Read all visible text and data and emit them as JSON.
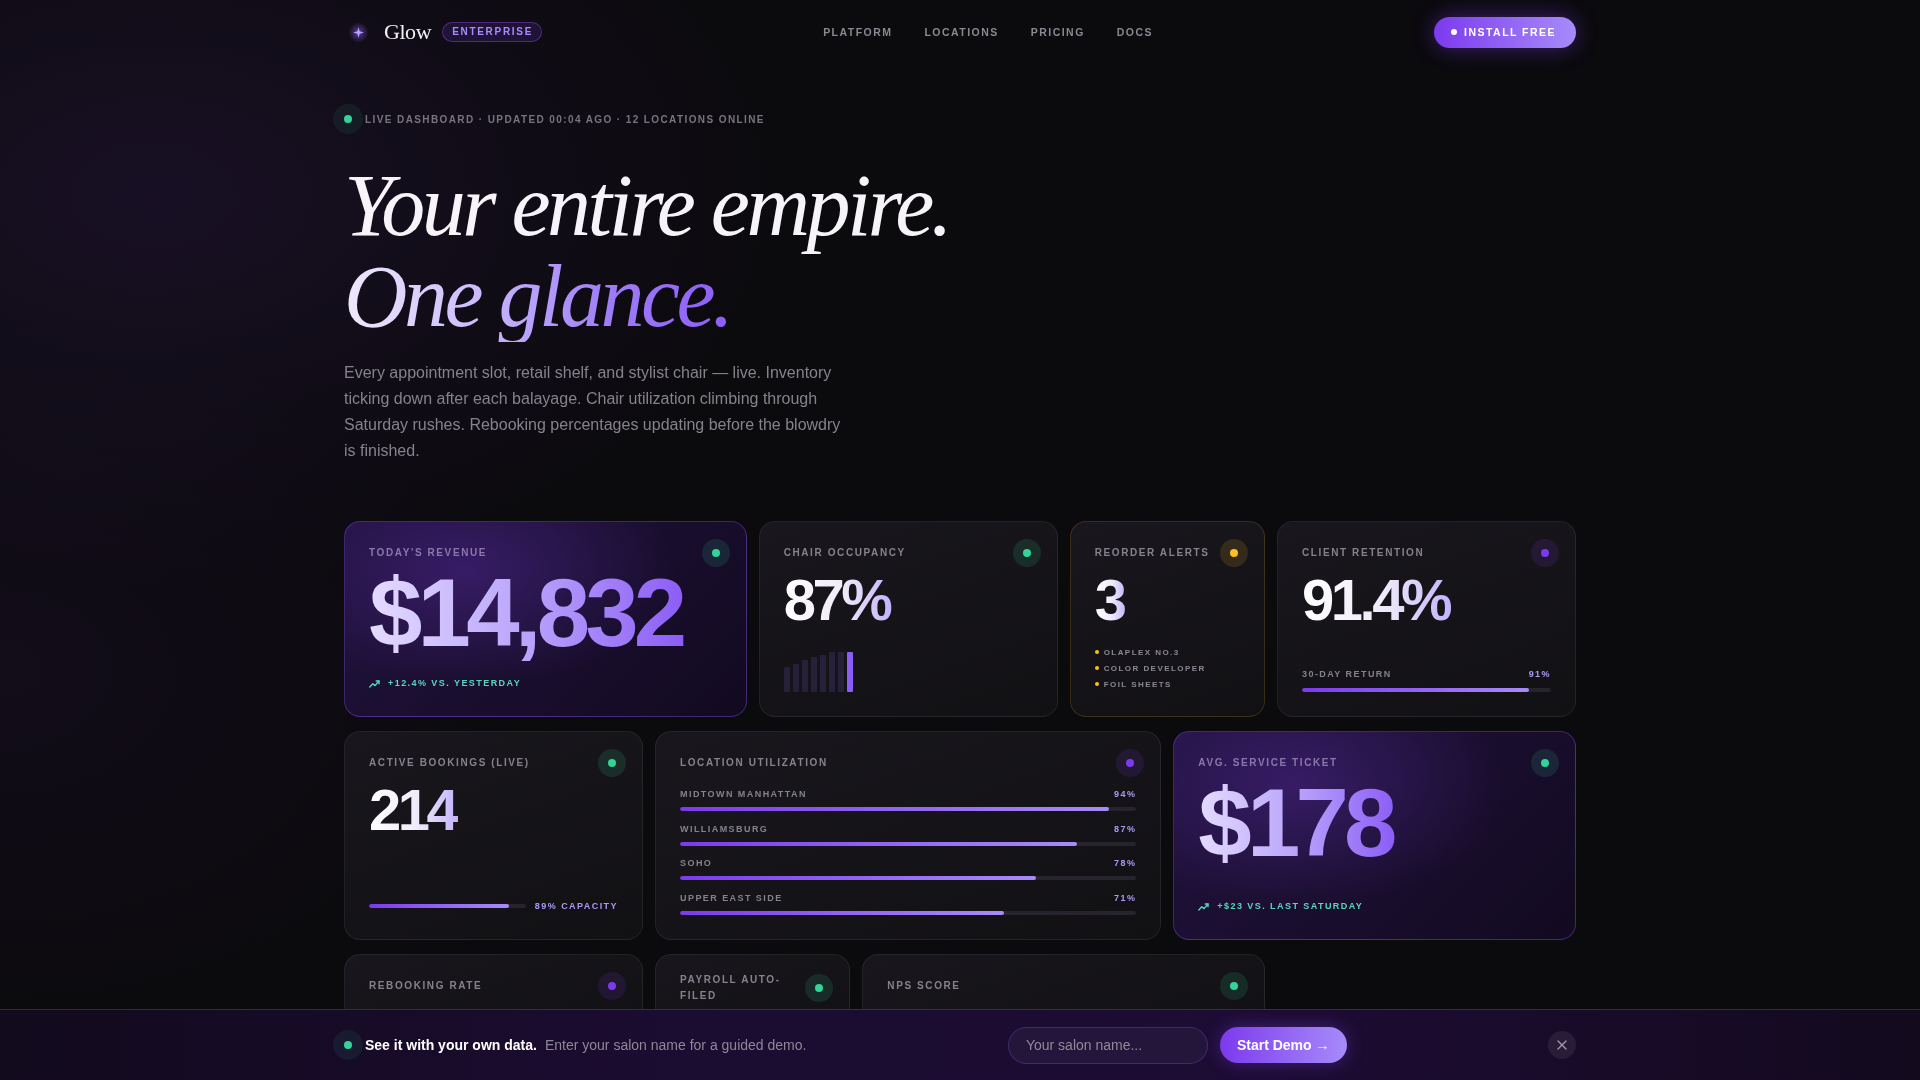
{
  "nav": {
    "brand": "Glow",
    "badge": "ENTERPRISE",
    "links": [
      "PLATFORM",
      "LOCATIONS",
      "PRICING",
      "DOCS"
    ],
    "cta": "INSTALL FREE"
  },
  "status": {
    "text": "LIVE DASHBOARD · UPDATED 00:04 AGO · 12 LOCATIONS ONLINE"
  },
  "headline": {
    "line_1": "Your entire empire.",
    "line_2": "One glance."
  },
  "intro": "Every appointment slot, retail shelf, and stylist chair — live. Inventory ticking down after each balayage. Chair utilization climbing through Saturday rushes. Rebooking percentages updating before the blowdry is finished.",
  "cards": [
    {
      "kind": "highlight",
      "label": "TODAY'S REVENUE",
      "color": "#34d399",
      "value": "$14,832",
      "trend": "+12.4% VS. YESTERDAY"
    },
    {
      "kind": "sparkline",
      "label": "CHAIR OCCUPANCY",
      "color": "#34d399",
      "value": "87%"
    },
    {
      "kind": "alerts",
      "label": "REORDER ALERTS",
      "color": "#fbbf24",
      "value": "3",
      "items": [
        "OLAPLEX NO.3",
        "COLOR DEVELOPER",
        "FOIL SHEETS"
      ]
    },
    {
      "kind": "progress",
      "label": "CLIENT RETENTION",
      "color": "#7c3aed",
      "value": "91.4%",
      "bar_label": "30-DAY RETURN",
      "reading": "91%",
      "level": 0.91
    },
    {
      "kind": "bookings",
      "label": "ACTIVE BOOKINGS (LIVE)",
      "color": "#34d399",
      "value": "214",
      "reading": "89% CAPACITY",
      "level": 0.89
    },
    {
      "kind": "locations",
      "label": "LOCATION UTILIZATION",
      "color": "#7c3aed",
      "locations": [
        {
          "name": "MIDTOWN MANHATTAN",
          "reading": "94%",
          "level": 0.94
        },
        {
          "name": "WILLIAMSBURG",
          "reading": "87%",
          "level": 0.87
        },
        {
          "name": "SOHO",
          "reading": "78%",
          "level": 0.78
        },
        {
          "name": "UPPER EAST SIDE",
          "reading": "71%",
          "level": 0.71
        }
      ]
    },
    {
      "kind": "highlight",
      "label": "AVG. SERVICE TICKET",
      "color": "#34d399",
      "value": "$178",
      "trend": "+$23 VS. LAST SATURDAY"
    },
    {
      "kind": "label_only",
      "label": "REBOOKING RATE",
      "color": "#7c3aed"
    },
    {
      "kind": "label_only",
      "label": "PAYROLL AUTO-FILED",
      "color": "#34d399"
    },
    {
      "kind": "label_only",
      "label": "NPS SCORE",
      "color": "#34d399"
    }
  ],
  "banner": {
    "title": "See it with your own data.",
    "text": "Enter your salon name for a guided demo.",
    "placeholder": "Your salon name...",
    "button": "Start Demo →"
  }
}
